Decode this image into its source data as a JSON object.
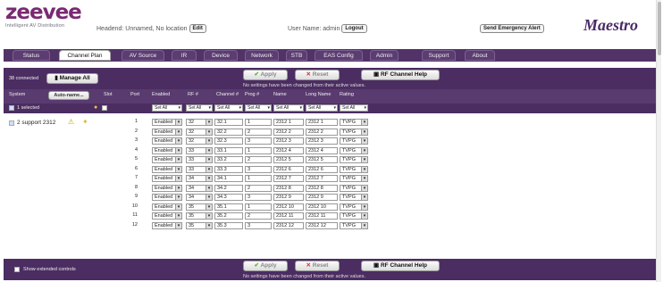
{
  "header": {
    "logo_text": "zeevee",
    "logo_tagline": "Intelligent AV Distribution",
    "headend_text": "Headend: Unnamed, No location",
    "edit_label": "Edit",
    "user_text": "User Name: admin",
    "logout_label": "Logout",
    "emergency_label": "Send Emergency Alert",
    "product": "Maestro"
  },
  "tabs": [
    {
      "label": "Status",
      "active": false
    },
    {
      "label": "Channel Plan",
      "active": true
    },
    {
      "label": "AV Source",
      "active": false
    },
    {
      "label": "IR",
      "active": false
    },
    {
      "label": "Device",
      "active": false
    },
    {
      "label": "Network",
      "active": false
    },
    {
      "label": "STB",
      "active": false
    },
    {
      "label": "EAS Config",
      "active": false
    },
    {
      "label": "Admin",
      "active": false
    },
    {
      "label": "Support",
      "active": false
    },
    {
      "label": "About",
      "active": false
    }
  ],
  "toolbar": {
    "connected_text": "38 connected",
    "manage_label": "Manage All",
    "apply_label": "Apply",
    "reset_label": "Reset",
    "help_label": "RF Channel Help",
    "no_changes_text": "No settings have been changed from their active values."
  },
  "columns": {
    "system": "System",
    "auto_name": "Auto-name...",
    "slot": "Slot",
    "port": "Port",
    "enabled": "Enabled",
    "rf": "RF #",
    "channel": "Channel #",
    "prog": "Prog #",
    "name": "Name",
    "long_name": "Long Name",
    "rating": "Rating"
  },
  "filters": {
    "selected_text": "1 selected",
    "enabled": "Set All",
    "rf": "Set All",
    "channel": "Set All",
    "prog": "Set All",
    "name": "Set All",
    "long_name": "Set All",
    "rating": "Set All"
  },
  "system": {
    "name": "2 support 2312"
  },
  "rows": [
    {
      "port": "1",
      "enabled": "Enabled",
      "rf": "32",
      "channel": "32.1",
      "prog": "1",
      "name": "2312 1",
      "long_name": "2312 1",
      "rating": "TVPG"
    },
    {
      "port": "2",
      "enabled": "Enabled",
      "rf": "32",
      "channel": "32.2",
      "prog": "2",
      "name": "2312 2",
      "long_name": "2312 2",
      "rating": "TVPG"
    },
    {
      "port": "3",
      "enabled": "Enabled",
      "rf": "32",
      "channel": "32.3",
      "prog": "3",
      "name": "2312 3",
      "long_name": "2312 3",
      "rating": "TVPG"
    },
    {
      "port": "4",
      "enabled": "Enabled",
      "rf": "33",
      "channel": "33.1",
      "prog": "1",
      "name": "2312 4",
      "long_name": "2312 4",
      "rating": "TVPG"
    },
    {
      "port": "5",
      "enabled": "Enabled",
      "rf": "33",
      "channel": "33.2",
      "prog": "2",
      "name": "2312 5",
      "long_name": "2312 5",
      "rating": "TVPG"
    },
    {
      "port": "6",
      "enabled": "Enabled",
      "rf": "33",
      "channel": "33.3",
      "prog": "3",
      "name": "2312 6",
      "long_name": "2312 6",
      "rating": "TVPG"
    },
    {
      "port": "7",
      "enabled": "Enabled",
      "rf": "34",
      "channel": "34.1",
      "prog": "1",
      "name": "2312 7",
      "long_name": "2312 7",
      "rating": "TVPG"
    },
    {
      "port": "8",
      "enabled": "Enabled",
      "rf": "34",
      "channel": "34.2",
      "prog": "2",
      "name": "2312 8",
      "long_name": "2312 8",
      "rating": "TVPG"
    },
    {
      "port": "9",
      "enabled": "Enabled",
      "rf": "34",
      "channel": "34.3",
      "prog": "3",
      "name": "2312 9",
      "long_name": "2312 9",
      "rating": "TVPG"
    },
    {
      "port": "10",
      "enabled": "Enabled",
      "rf": "35",
      "channel": "35.1",
      "prog": "1",
      "name": "2312 10",
      "long_name": "2312 10",
      "rating": "TVPG"
    },
    {
      "port": "11",
      "enabled": "Enabled",
      "rf": "35",
      "channel": "35.2",
      "prog": "2",
      "name": "2312 11",
      "long_name": "2312 11",
      "rating": "TVPG"
    },
    {
      "port": "12",
      "enabled": "Enabled",
      "rf": "35",
      "channel": "35.3",
      "prog": "3",
      "name": "2312 12",
      "long_name": "2312 12",
      "rating": "TVPG"
    }
  ],
  "footer": {
    "show_extended_label": "Show extended controls",
    "no_changes_text": "No settings have been changed from their active values."
  },
  "colors": {
    "brand": "#7a2a73",
    "bar": "#4b2d62"
  }
}
